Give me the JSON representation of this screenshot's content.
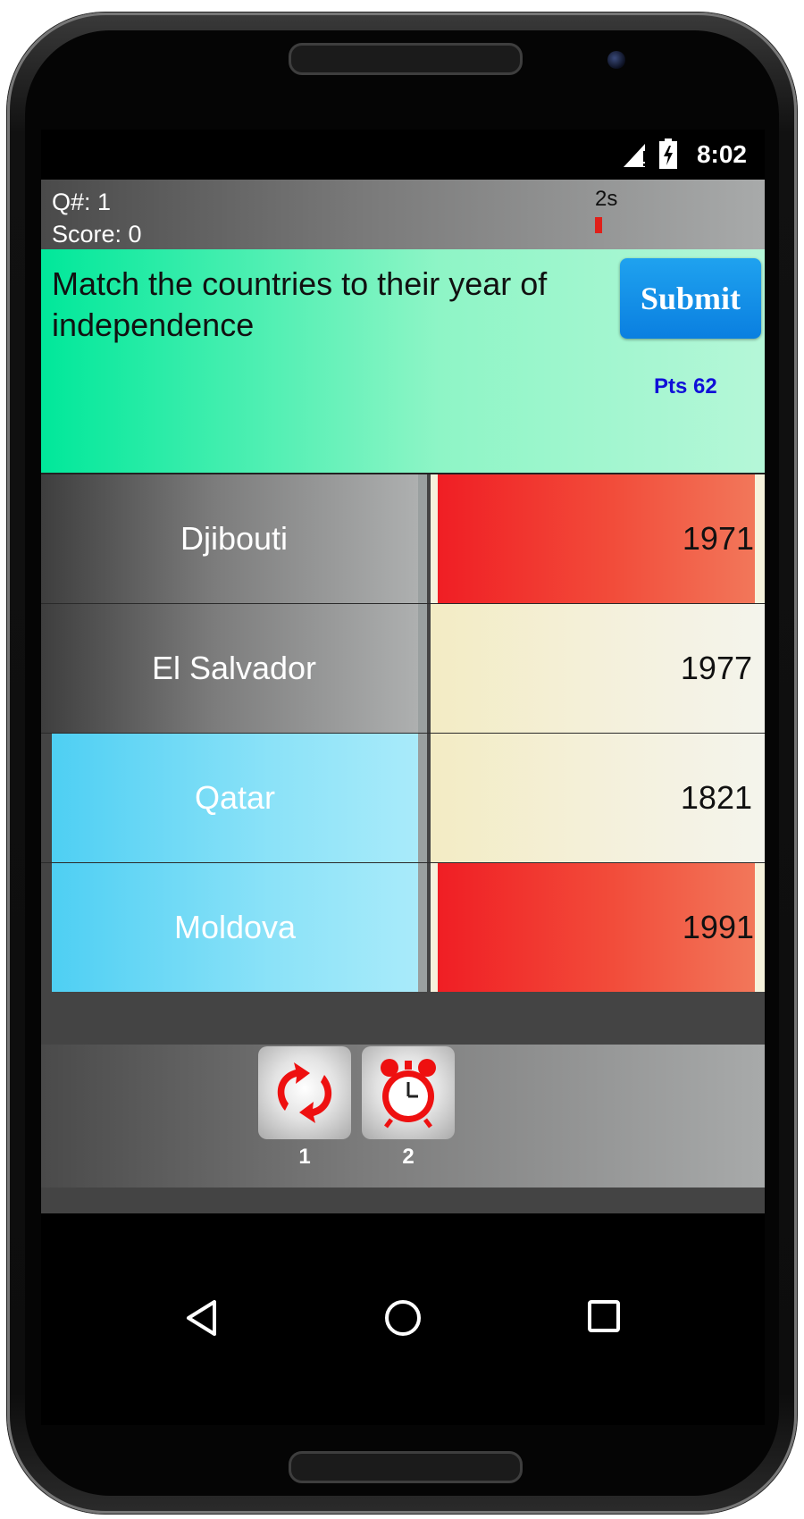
{
  "status_bar": {
    "time": "8:02"
  },
  "header": {
    "question_number": "Q#: 1",
    "score": "Score: 0",
    "timer": "2s",
    "timer_fraction": 0.03
  },
  "question": {
    "text": "Match the countries to their year of independence",
    "submit_label": "Submit",
    "points": "Pts 62"
  },
  "rows": [
    {
      "country": "Djibouti",
      "year": "1971",
      "country_style": "grey",
      "year_style": "red"
    },
    {
      "country": "El Salvador",
      "year": "1977",
      "country_style": "grey",
      "year_style": "cream"
    },
    {
      "country": "Qatar",
      "year": "1821",
      "country_style": "blue",
      "year_style": "cream"
    },
    {
      "country": "Moldova",
      "year": "1991",
      "country_style": "blue",
      "year_style": "red"
    }
  ],
  "tools": [
    {
      "name": "refresh",
      "count": "1"
    },
    {
      "name": "alarm-clock",
      "count": "2"
    }
  ],
  "colors": {
    "question_bg": "#00e89a",
    "submit_bg": "#1fa2ef",
    "points_text": "#1010d8",
    "selected_country": "#4ecff3",
    "incorrect_year": "#f01e24",
    "timer_bar": "#e0201a"
  }
}
